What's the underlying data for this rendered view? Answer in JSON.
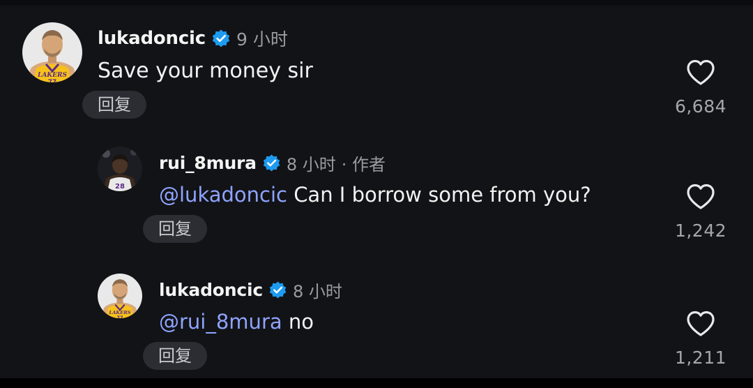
{
  "comments": [
    {
      "username": "lukadoncic",
      "time": "9 小时",
      "author_tag": "",
      "mention": "",
      "text": "Save your money sir",
      "reply_label": "回复",
      "like_count": "6,684",
      "verified": true,
      "avatar_icon": "player-avatar-lakers-77"
    },
    {
      "username": "rui_8mura",
      "time": "8 小时",
      "author_tag": "· 作者",
      "mention": "@lukadoncic",
      "text": "Can I borrow some from you?",
      "reply_label": "回复",
      "like_count": "1,242",
      "verified": true,
      "avatar_icon": "player-avatar-lakers-28"
    },
    {
      "username": "lukadoncic",
      "time": "8 小时",
      "author_tag": "",
      "mention": "@rui_8mura",
      "text": "no",
      "reply_label": "回复",
      "like_count": "1,211",
      "verified": true,
      "avatar_icon": "player-avatar-lakers-77"
    }
  ],
  "colors": {
    "background": "#121316",
    "mention": "#8fa3ff",
    "verified_badge": "#1d9bf0",
    "meta_text": "#9a9ca2",
    "reply_button_bg": "#2b2d33",
    "lakers_gold": "#f6c21a",
    "lakers_purple": "#5b2a86"
  },
  "icons": {
    "like": "heart-outline-icon",
    "verified": "verified-badge-icon"
  }
}
